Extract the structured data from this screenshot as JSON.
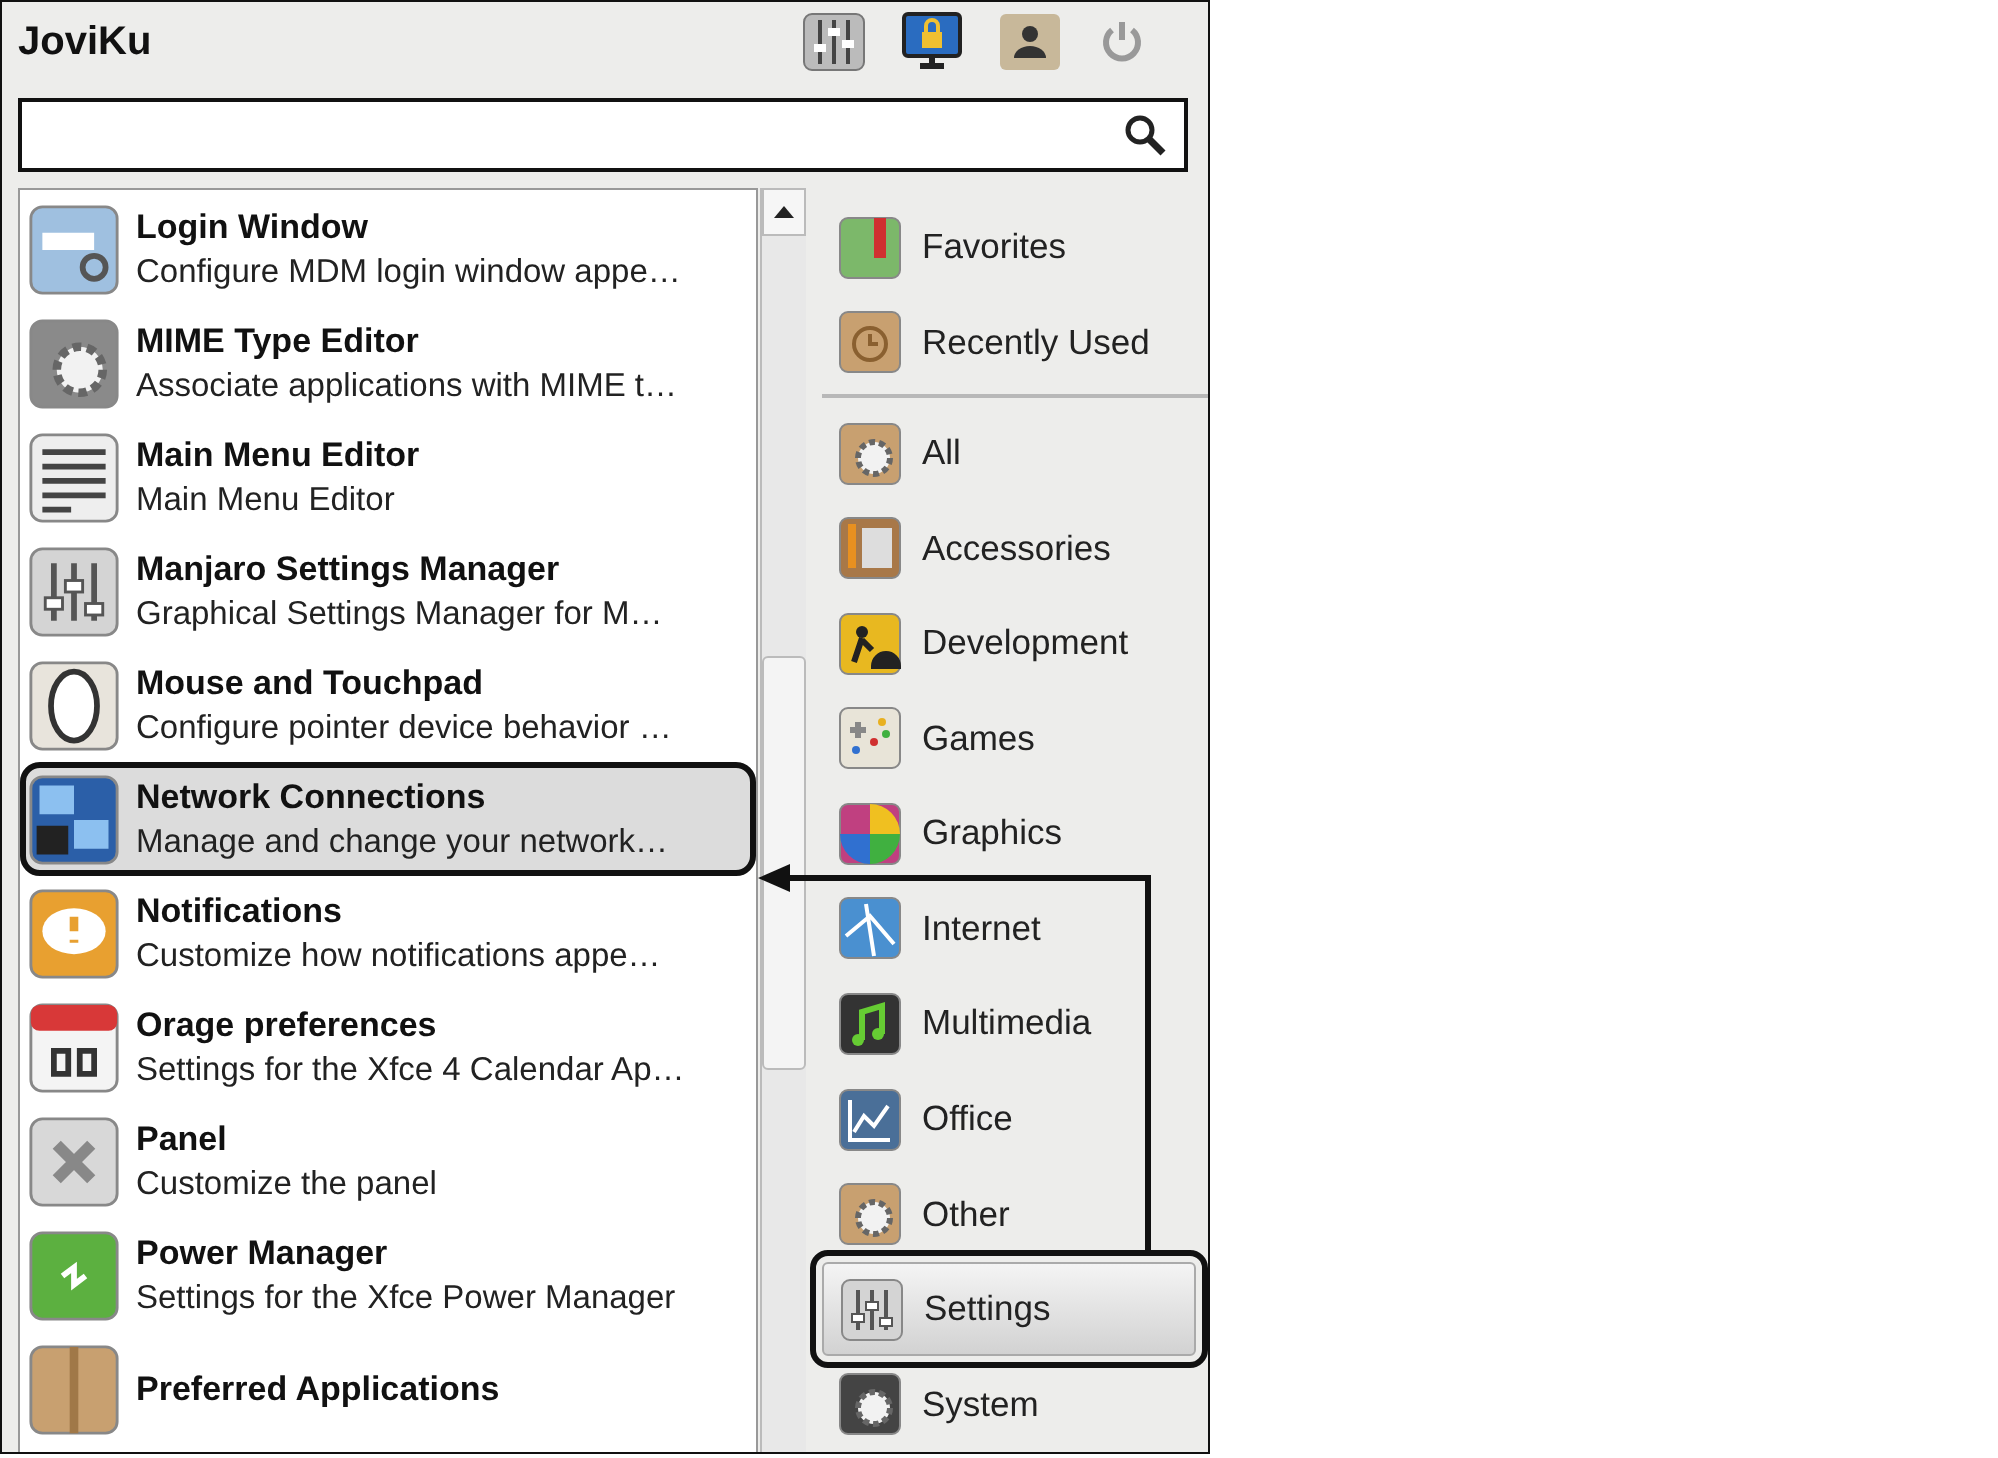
{
  "window": {
    "title": "JoviKu"
  },
  "apps": [
    {
      "name": "Login Window",
      "description": "Configure MDM login window appe…",
      "selected": false
    },
    {
      "name": "MIME Type Editor",
      "description": "Associate applications with MIME t…",
      "selected": false
    },
    {
      "name": "Main Menu Editor",
      "description": "Main Menu Editor",
      "selected": false
    },
    {
      "name": "Manjaro Settings Manager",
      "description": "Graphical Settings Manager for M…",
      "selected": false
    },
    {
      "name": "Mouse and Touchpad",
      "description": "Configure pointer device behavior …",
      "selected": false
    },
    {
      "name": "Network Connections",
      "description": "Manage and change your network…",
      "selected": true
    },
    {
      "name": "Notifications",
      "description": "Customize how notifications appe…",
      "selected": false
    },
    {
      "name": "Orage preferences",
      "description": "Settings for the Xfce 4 Calendar Ap…",
      "selected": false
    },
    {
      "name": "Panel",
      "description": "Customize the panel",
      "selected": false
    },
    {
      "name": "Power Manager",
      "description": "Settings for the Xfce Power Manager",
      "selected": false
    },
    {
      "name": "Preferred Applications",
      "selected": false
    }
  ],
  "places": [
    {
      "label": "Favorites",
      "selected": false
    },
    {
      "label": "Recently Used",
      "selected": false
    }
  ],
  "categories": [
    {
      "label": "All",
      "selected": false
    },
    {
      "label": "Accessories",
      "selected": false
    },
    {
      "label": "Development",
      "selected": false
    },
    {
      "label": "Games",
      "selected": false
    },
    {
      "label": "Graphics",
      "selected": false
    },
    {
      "label": "Internet",
      "selected": false
    },
    {
      "label": "Multimedia",
      "selected": false
    },
    {
      "label": "Office",
      "selected": false
    },
    {
      "label": "Other",
      "selected": false
    },
    {
      "label": "Settings",
      "selected": true
    },
    {
      "label": "System",
      "selected": false
    }
  ]
}
